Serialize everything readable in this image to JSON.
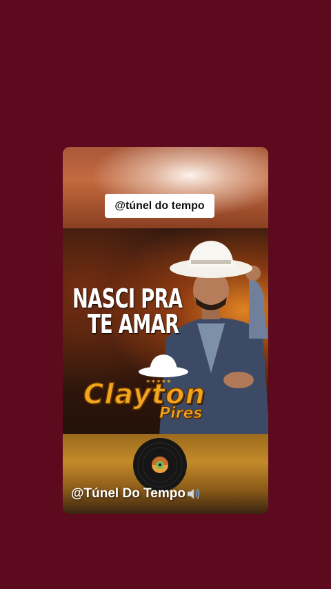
{
  "overlay": {
    "handle_label": "@túnel do tempo"
  },
  "cover": {
    "title_line1": "NASCI PRA",
    "title_line2": "TE AMAR",
    "artist_first": "Clayton",
    "artist_last": "Pires"
  },
  "music_bar": {
    "sound_label": "@Túnel Do Tempo",
    "icon": "speaker-icon",
    "disc_icon": "vinyl-record-icon"
  },
  "colors": {
    "background": "#5d0a1e",
    "artist_name": "#f2a51e"
  }
}
